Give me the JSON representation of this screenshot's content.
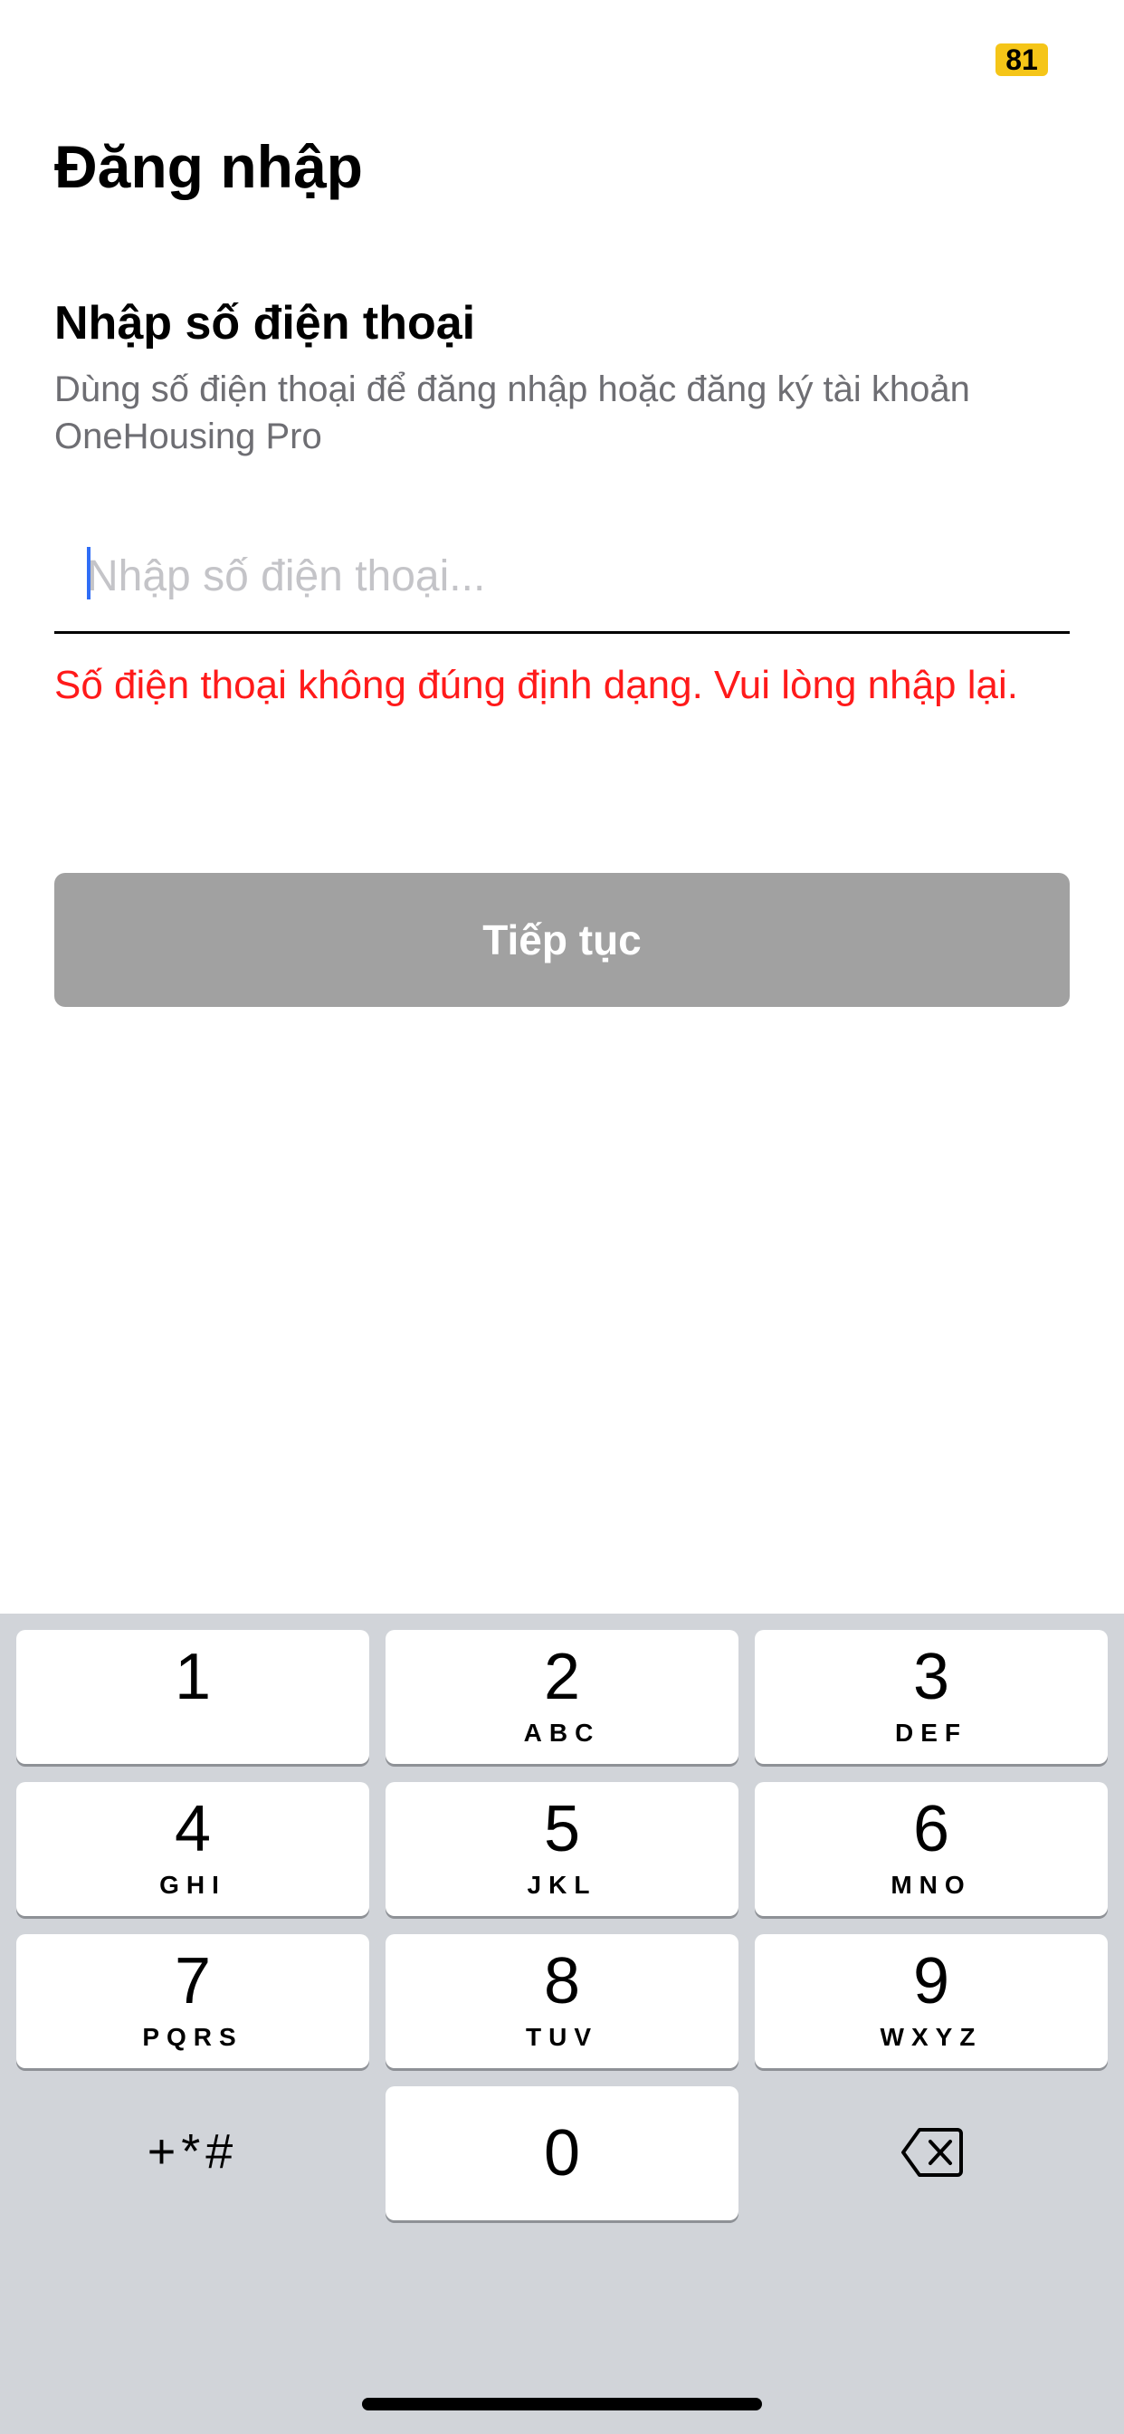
{
  "status_bar": {
    "badge": "81"
  },
  "header": {
    "title": "Đăng nhập"
  },
  "form": {
    "heading": "Nhập số điện thoại",
    "description": "Dùng số điện thoại để đăng nhập hoặc đăng ký tài khoản OneHousing Pro",
    "phone_input": {
      "value": "",
      "placeholder": "Nhập số điện thoại..."
    },
    "error": "Số điện thoại không đúng định dạng. Vui lòng nhập lại.",
    "continue_label": "Tiếp tục"
  },
  "keyboard": {
    "keys": [
      {
        "digit": "1",
        "letters": ""
      },
      {
        "digit": "2",
        "letters": "ABC"
      },
      {
        "digit": "3",
        "letters": "DEF"
      },
      {
        "digit": "4",
        "letters": "GHI"
      },
      {
        "digit": "5",
        "letters": "JKL"
      },
      {
        "digit": "6",
        "letters": "MNO"
      },
      {
        "digit": "7",
        "letters": "PQRS"
      },
      {
        "digit": "8",
        "letters": "TUV"
      },
      {
        "digit": "9",
        "letters": "WXYZ"
      },
      {
        "digit": "0",
        "letters": ""
      }
    ],
    "symbols_label": "+*#",
    "backspace_icon": "backspace-icon"
  },
  "colors": {
    "error": "#ff1a1a",
    "button_disabled": "#a1a1a1",
    "badge": "#f5c518",
    "keyboard_bg": "#d1d4d9"
  }
}
